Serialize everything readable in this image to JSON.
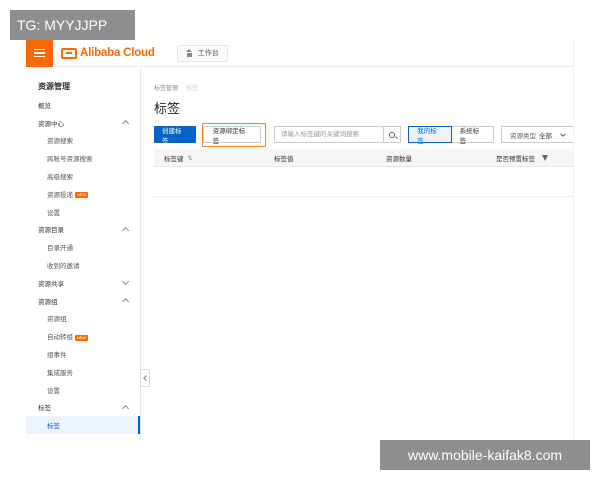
{
  "overlay": {
    "tag": "TG: MYYJJPP",
    "watermark": "www.mobile-kaifak8.com"
  },
  "topbar": {
    "brand": "Alibaba Cloud",
    "workbench": "工作台"
  },
  "sidebar": {
    "title": "资源管理",
    "items": [
      {
        "label": "概览",
        "level": 1
      },
      {
        "label": "资源中心",
        "level": 1,
        "expand": "up"
      },
      {
        "label": "资源搜索",
        "level": 2
      },
      {
        "label": "跨账号资源搜索",
        "level": 2
      },
      {
        "label": "高级搜索",
        "level": 2
      },
      {
        "label": "资源投递",
        "level": 2,
        "badge": "NEW"
      },
      {
        "label": "设置",
        "level": 2
      },
      {
        "label": "资源目录",
        "level": 1,
        "expand": "up"
      },
      {
        "label": "目录开通",
        "level": 2
      },
      {
        "label": "收到的邀请",
        "level": 2
      },
      {
        "label": "资源共享",
        "level": 1,
        "expand": "down"
      },
      {
        "label": "资源组",
        "level": 1,
        "expand": "up"
      },
      {
        "label": "资源组",
        "level": 2
      },
      {
        "label": "自动转组",
        "level": 2,
        "badge": "NEW"
      },
      {
        "label": "组事件",
        "level": 2
      },
      {
        "label": "集成服务",
        "level": 2
      },
      {
        "label": "设置",
        "level": 2
      },
      {
        "label": "标签",
        "level": 1,
        "expand": "up"
      },
      {
        "label": "标签",
        "level": 2,
        "active": true
      }
    ]
  },
  "main": {
    "breadcrumb": {
      "parent": "标签管理",
      "current": "标签"
    },
    "title": "标签",
    "toolbar": {
      "create": "创建标签",
      "bind": "资源绑定标签",
      "search_placeholder": "请输入标签键的关键词搜索",
      "seg_mine": "我的标签",
      "seg_system": "系统标签",
      "select_label": "资源类型",
      "select_value": "全部"
    },
    "table": {
      "headers": [
        "标签键",
        "标签值",
        "资源数量",
        "是否预置标签"
      ],
      "sort_glyph": "⇅"
    }
  },
  "colors": {
    "brand": "#ff6a00",
    "primary": "#0064c8",
    "highlight": "#e0883a"
  }
}
